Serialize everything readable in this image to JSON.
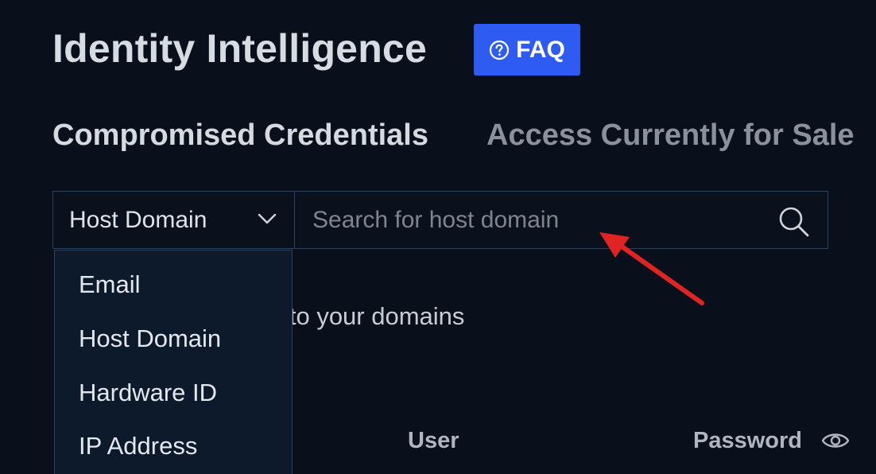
{
  "header": {
    "title": "Identity Intelligence",
    "faq_label": "FAQ"
  },
  "tabs": [
    {
      "label": "Compromised Credentials",
      "active": true
    },
    {
      "label": "Access Currently for Sale",
      "active": false
    }
  ],
  "search": {
    "filter_selected": "Host Domain",
    "placeholder": "Search for host domain",
    "value": ""
  },
  "dropdown": {
    "options": [
      "Email",
      "Host Domain",
      "Hardware ID",
      "IP Address"
    ]
  },
  "partial_text": "d to your domains",
  "table": {
    "columns": [
      "User",
      "Password"
    ]
  },
  "annotation": {
    "arrow_color": "#e02323"
  },
  "colors": {
    "background": "#0a101b",
    "accent": "#2e5cf2",
    "border": "#28415d"
  },
  "icons": {
    "faq": "question-circle-icon",
    "chevron": "chevron-down-icon",
    "search": "search-icon",
    "eye": "eye-icon"
  }
}
